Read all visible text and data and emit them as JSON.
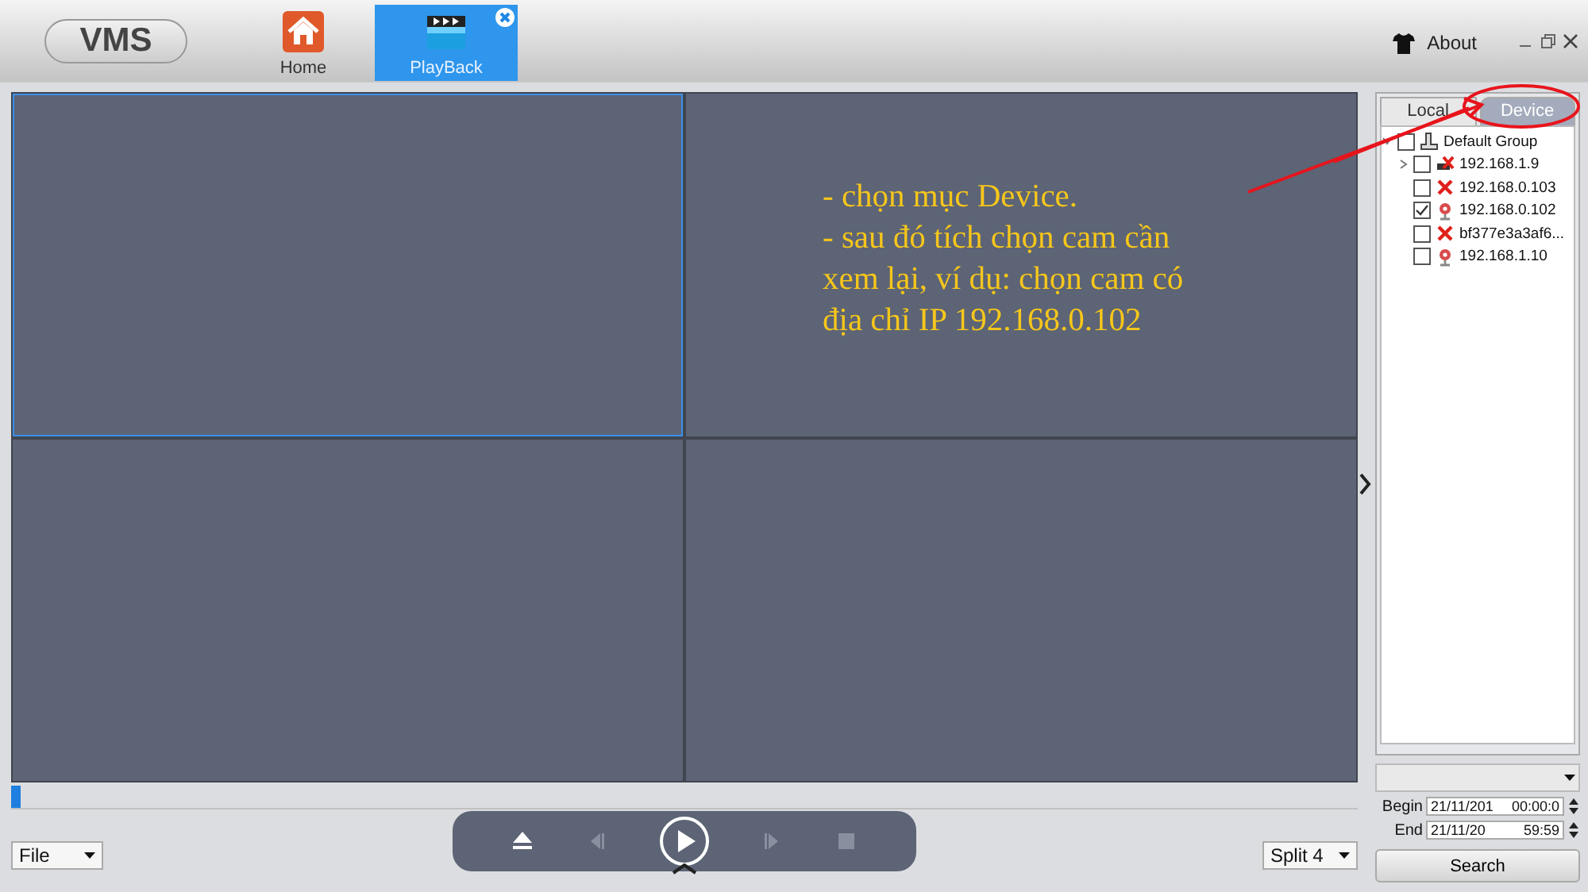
{
  "app": {
    "logo": "VMS",
    "about": "About"
  },
  "nav_tabs": [
    {
      "label": "Home",
      "kind": "home",
      "selected": false,
      "closable": false
    },
    {
      "label": "PlayBack",
      "kind": "playback",
      "selected": true,
      "closable": true
    }
  ],
  "video_grid": [
    {
      "selected": true
    },
    {
      "selected": false
    },
    {
      "selected": false
    },
    {
      "selected": false
    }
  ],
  "note": {
    "lines": [
      "- chọn mục Device.",
      "- sau đó tích chọn cam cần",
      "xem lại, ví dụ: chọn cam có",
      "địa chỉ IP 192.168.0.102"
    ]
  },
  "panel": {
    "tabs": [
      {
        "label": "Local",
        "selected": false
      },
      {
        "label": "Device",
        "selected": true
      }
    ],
    "tree": {
      "label": "Default Group",
      "expanded": true,
      "checked": false,
      "children": [
        {
          "label": "192.168.1.9",
          "kind": "linked",
          "checked": false,
          "expandable": true
        },
        {
          "label": "192.168.0.103",
          "kind": "offline",
          "checked": false,
          "expandable": false
        },
        {
          "label": "192.168.0.102",
          "kind": "online",
          "checked": true,
          "expandable": false
        },
        {
          "label": "bf377e3a3af6...",
          "kind": "offline",
          "checked": false,
          "expandable": false
        },
        {
          "label": "192.168.1.10",
          "kind": "online",
          "checked": false,
          "expandable": false
        }
      ]
    },
    "begin": {
      "label": "Begin",
      "date": "21/11/201",
      "time": "00:00:0"
    },
    "end": {
      "label": "End",
      "date": "21/11/20",
      "time": "59:59"
    },
    "search": "Search"
  },
  "file_select": "File",
  "split_select": "Split 4"
}
